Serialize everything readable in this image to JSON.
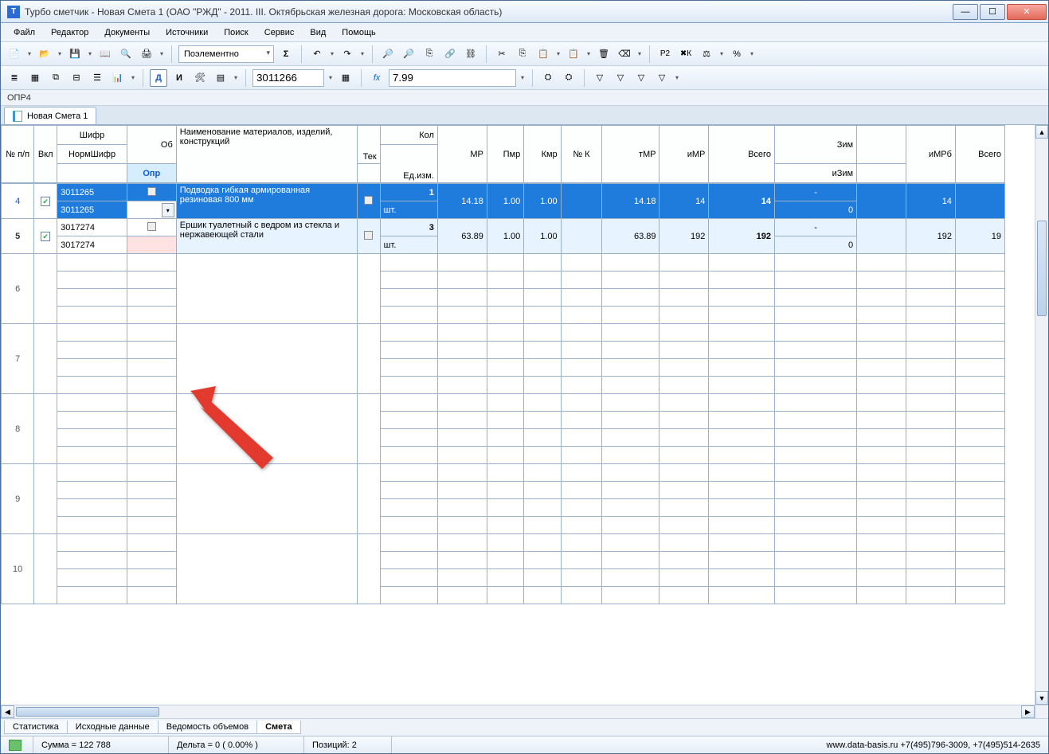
{
  "title": "Турбо сметчик - Новая Смета 1 (ОАО \"РЖД\" - 2011. III. Октябрьская железная дорога: Московская область)",
  "menu": {
    "file": "Файл",
    "editor": "Редактор",
    "documents": "Документы",
    "sources": "Источники",
    "search": "Поиск",
    "service": "Сервис",
    "view": "Вид",
    "help": "Помощь"
  },
  "toolbar1": {
    "modeDropdown": "Поэлементно"
  },
  "toolbar2": {
    "codeInput": "3011266",
    "valueInput": "7.99"
  },
  "context": "ОПР4",
  "docTab": "Новая Смета 1",
  "headers": {
    "num": "№ п/п",
    "vkl": "Вкл",
    "shifr": "Шифр",
    "normShifr": "НормШифр",
    "ob": "Об",
    "opr": "Опр",
    "name": "Наименование материалов, изделий, конструкций",
    "tek": "Тек",
    "kol": "Кол",
    "ed": "Ед.изм.",
    "mr": "МР",
    "pmr": "Пмр",
    "kmr": "Кмр",
    "nk": "№ К",
    "tmr": "тМР",
    "imr": "иМР",
    "vsego": "Всего",
    "zim": "Зим",
    "izim": "иЗим",
    "imrb": "иМРб",
    "vsego2": "Всего"
  },
  "rows": {
    "r4": {
      "num": "4",
      "code1": "3011265",
      "code2": "3011265",
      "name": "Подводка гибкая армированная резиновая 800 мм",
      "kol": "1",
      "ed": "шт.",
      "mr": "14.18",
      "pmr": "1.00",
      "kmr": "1.00",
      "tmr": "14.18",
      "imr": "14",
      "vsego": "14",
      "zim": "-",
      "izim": "0",
      "imrb": "14"
    },
    "r5": {
      "num": "5",
      "code1": "3017274",
      "code2": "3017274",
      "name": "Ершик туалетный с ведром из стекла и нержавеющей стали",
      "kol": "3",
      "ed": "шт.",
      "mr": "63.89",
      "pmr": "1.00",
      "kmr": "1.00",
      "tmr": "63.89",
      "imr": "192",
      "vsego": "192",
      "zim": "-",
      "izim": "0",
      "imrb": "192",
      "vsego2": "19"
    }
  },
  "emptyRowNums": [
    "6",
    "7",
    "8",
    "9",
    "10"
  ],
  "bottomTabs": {
    "stat": "Статистика",
    "src": "Исходные данные",
    "vol": "Ведомость объемов",
    "smeta": "Смета"
  },
  "status": {
    "sum": "Сумма = 122 788",
    "delta": "Дельта = 0 ( 0.00% )",
    "pos": "Позиций: 2",
    "right": "www.data-basis.ru  +7(495)796-3009, +7(495)514-2635"
  }
}
